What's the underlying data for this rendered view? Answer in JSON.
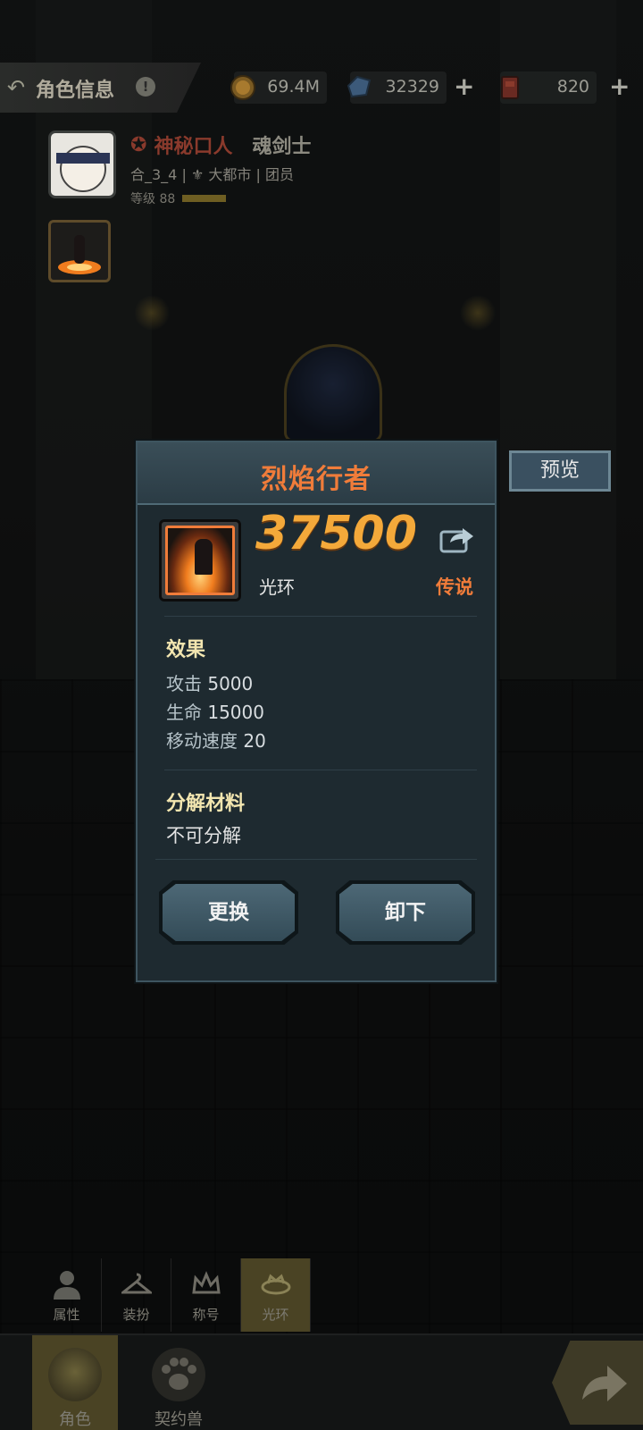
{
  "topbar": {
    "title": "角色信息",
    "info_icon": "!",
    "currencies": [
      {
        "icon": "gold-coin-icon",
        "value": "69.4M"
      },
      {
        "icon": "diamond-icon",
        "value": "32329"
      },
      {
        "icon": "ticket-icon",
        "value": "820"
      }
    ],
    "plus": "+"
  },
  "profile": {
    "name": "神秘口人",
    "class": "魂剑士",
    "server": "合_3_4",
    "guild": "大都市",
    "role": "团员",
    "level_label": "等级 88",
    "level_progress": 0.45,
    "separator": "|"
  },
  "modal": {
    "title": "烈焰行者",
    "power": "37500",
    "type": "光环",
    "rarity": "传说",
    "effects_title": "效果",
    "effects": [
      {
        "key": "攻击",
        "value": "5000"
      },
      {
        "key": "生命",
        "value": "15000"
      },
      {
        "key": "移动速度",
        "value": "20"
      }
    ],
    "material_title": "分解材料",
    "material_note": "不可分解",
    "replace_label": "更换",
    "unequip_label": "卸下"
  },
  "preview_label": "预览",
  "subtabs": [
    {
      "label": "属性",
      "icon": "person-icon"
    },
    {
      "label": "装扮",
      "icon": "hanger-icon"
    },
    {
      "label": "称号",
      "icon": "crown-icon"
    },
    {
      "label": "光环",
      "icon": "halo-icon",
      "active": true
    }
  ],
  "maintabs": [
    {
      "label": "角色",
      "icon": "helmet-icon",
      "active": true
    },
    {
      "label": "契约兽",
      "icon": "paw-icon"
    }
  ],
  "colors": {
    "accent_orange": "#f07c3a",
    "power_gold": "#f4a93a",
    "panel": "#1e2a30",
    "active_tab": "#4a4324"
  }
}
